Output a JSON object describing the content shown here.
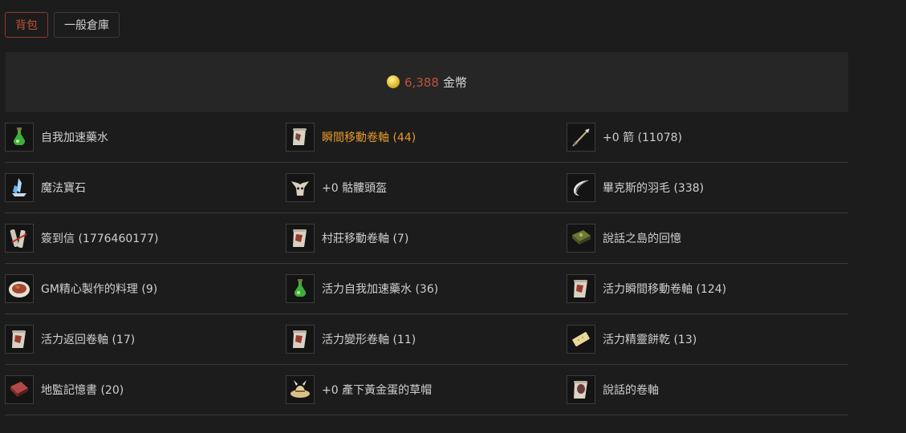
{
  "tabs": [
    {
      "label": "背包",
      "active": true
    },
    {
      "label": "一般倉庫",
      "active": false
    }
  ],
  "currency": {
    "icon": "coin-icon",
    "amount": "6,388",
    "unit": "金幣"
  },
  "items": [
    {
      "label": "自我加速藥水",
      "icon": "green-potion-icon",
      "highlight": false
    },
    {
      "label": "瞬間移動卷軸 (44)",
      "icon": "scroll-icon",
      "highlight": true
    },
    {
      "label": "+0 箭 (11078)",
      "icon": "arrow-icon",
      "highlight": false
    },
    {
      "label": "魔法寶石",
      "icon": "crystal-icon",
      "highlight": false
    },
    {
      "label": "+0 骷髏頭盔",
      "icon": "skull-helmet-icon",
      "highlight": false
    },
    {
      "label": "畢克斯的羽毛 (338)",
      "icon": "feather-icon",
      "highlight": false
    },
    {
      "label": "簽到信 (1776460177)",
      "icon": "letter-icon",
      "highlight": false
    },
    {
      "label": "村莊移動卷軸 (7)",
      "icon": "red-scroll-icon",
      "highlight": false
    },
    {
      "label": "說話之島的回憶",
      "icon": "green-book-icon",
      "highlight": false
    },
    {
      "label": "GM精心製作的料理 (9)",
      "icon": "dish-icon",
      "highlight": false
    },
    {
      "label": "活力自我加速藥水 (36)",
      "icon": "green-potion-icon",
      "highlight": false
    },
    {
      "label": "活力瞬間移動卷軸 (124)",
      "icon": "red-scroll-icon",
      "highlight": false
    },
    {
      "label": "活力返回卷軸 (17)",
      "icon": "red-scroll-icon",
      "highlight": false
    },
    {
      "label": "活力變形卷軸 (11)",
      "icon": "red-scroll-icon",
      "highlight": false
    },
    {
      "label": "活力精靈餅乾 (13)",
      "icon": "cookie-icon",
      "highlight": false
    },
    {
      "label": "地監記憶書 (20)",
      "icon": "red-book-icon",
      "highlight": false
    },
    {
      "label": "+0 產下黃金蛋的草帽",
      "icon": "straw-hat-icon",
      "highlight": false
    },
    {
      "label": "說話的卷軸",
      "icon": "talking-scroll-icon",
      "highlight": false
    }
  ]
}
